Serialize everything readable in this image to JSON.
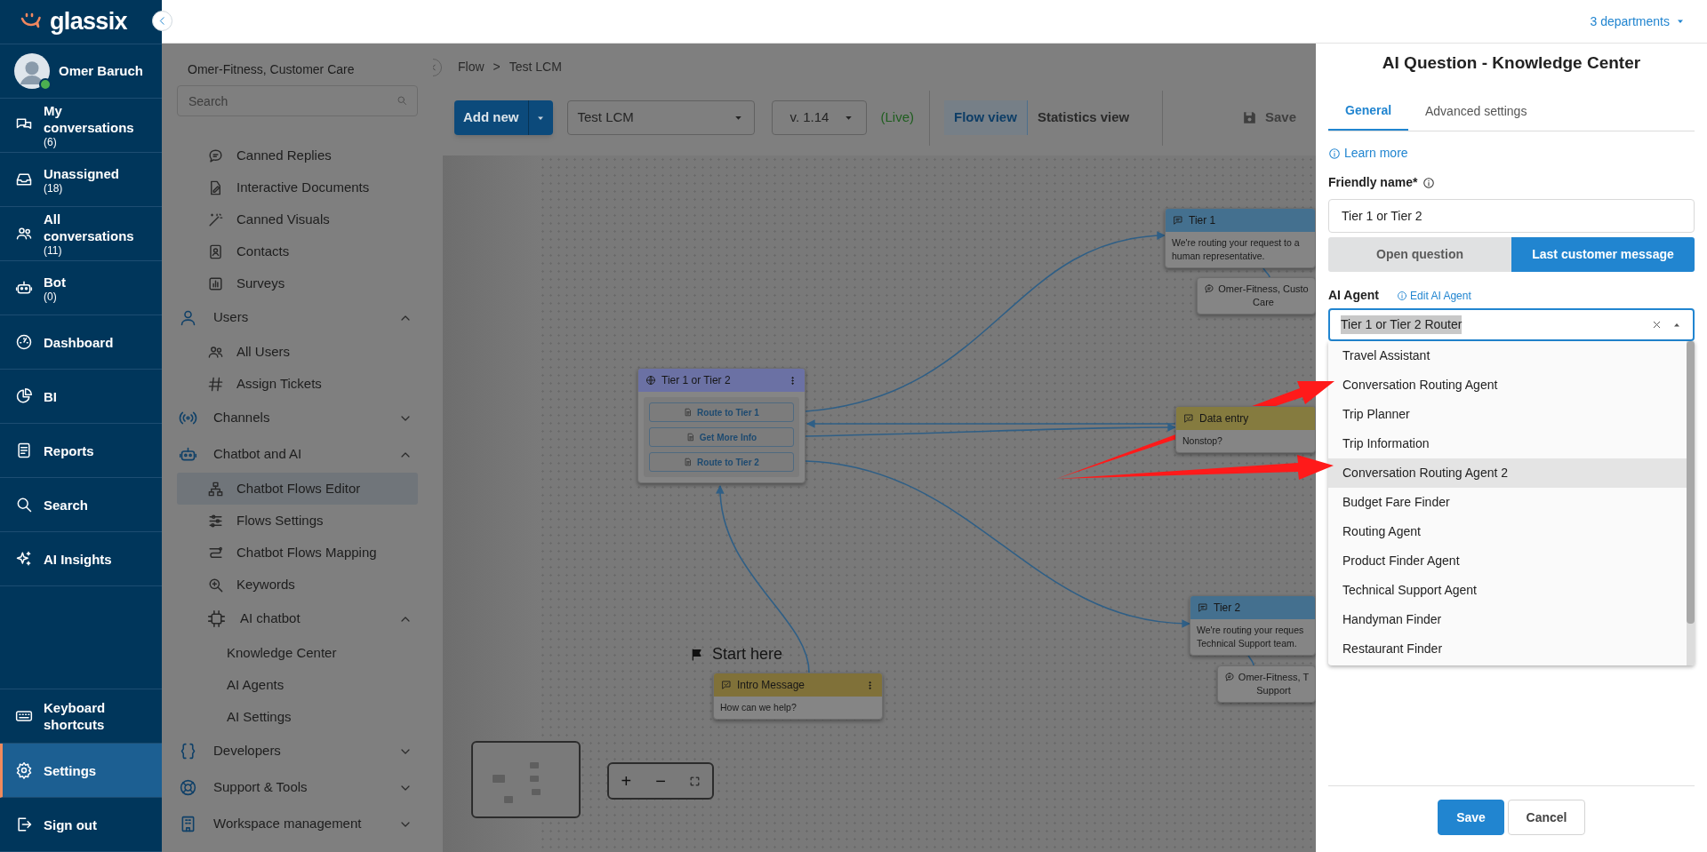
{
  "brand": {
    "name": "glassix"
  },
  "topbar": {
    "departments": "3 departments"
  },
  "user": {
    "name": "Omer Baruch",
    "online": true
  },
  "nav": {
    "items": [
      {
        "label": "My conversations",
        "count": "(6)",
        "selected": false
      },
      {
        "label": "Unassigned",
        "count": "(18)",
        "selected": false
      },
      {
        "label": "All conversations",
        "count": "(11)",
        "selected": false
      },
      {
        "label": "Bot",
        "count": "(0)",
        "selected": false
      },
      {
        "label": "Dashboard",
        "selected": false
      },
      {
        "label": "BI",
        "selected": false
      },
      {
        "label": "Reports",
        "selected": false
      },
      {
        "label": "Search",
        "selected": false
      },
      {
        "label": "AI Insights",
        "selected": false
      }
    ],
    "bottom_items": [
      {
        "label": "Keyboard shortcuts",
        "selected": false
      },
      {
        "label": "Settings",
        "selected": true
      },
      {
        "label": "Sign out",
        "selected": false
      }
    ]
  },
  "settings_nav": {
    "workspace": "Omer-Fitness, Customer Care",
    "search_placeholder": "Search",
    "items": [
      {
        "kind": "item",
        "label": "Canned Replies",
        "selected": false
      },
      {
        "kind": "item",
        "label": "Interactive Documents",
        "selected": false
      },
      {
        "kind": "item",
        "label": "Canned Visuals",
        "selected": false
      },
      {
        "kind": "item",
        "label": "Contacts",
        "selected": false
      },
      {
        "kind": "item",
        "label": "Surveys",
        "selected": false
      },
      {
        "kind": "section",
        "label": "Users",
        "expanded": true,
        "children": [
          {
            "kind": "item",
            "label": "All Users",
            "selected": false
          },
          {
            "kind": "item",
            "label": "Assign Tickets",
            "selected": false
          }
        ]
      },
      {
        "kind": "section",
        "label": "Channels",
        "expanded": false
      },
      {
        "kind": "section",
        "label": "Chatbot and AI",
        "expanded": true,
        "children": [
          {
            "kind": "item",
            "label": "Chatbot Flows Editor",
            "selected": true
          },
          {
            "kind": "item",
            "label": "Flows Settings",
            "selected": false
          },
          {
            "kind": "item",
            "label": "Chatbot Flows Mapping",
            "selected": false
          },
          {
            "kind": "item",
            "label": "Keywords",
            "selected": false
          },
          {
            "kind": "section",
            "label": "AI chatbot",
            "expanded": true,
            "children": [
              {
                "kind": "leaf",
                "label": "Knowledge Center",
                "selected": false
              },
              {
                "kind": "leaf",
                "label": "AI Agents",
                "selected": false
              },
              {
                "kind": "leaf",
                "label": "AI Settings",
                "selected": false
              }
            ]
          }
        ]
      },
      {
        "kind": "section",
        "label": "Developers",
        "expanded": false
      },
      {
        "kind": "section",
        "label": "Support & Tools",
        "expanded": false
      },
      {
        "kind": "section",
        "label": "Workspace management",
        "expanded": false
      }
    ]
  },
  "flow_editor": {
    "breadcrumb": [
      "Flow",
      "Test LCM"
    ],
    "breadcrumb_separator": ">",
    "add_button": "Add new",
    "flow_select": "Test LCM",
    "version_select": "v. 1.14",
    "status": "(Live)",
    "views": [
      {
        "label": "Flow view",
        "selected": true
      },
      {
        "label": "Statistics view",
        "selected": false
      }
    ],
    "save": {
      "label": "Save",
      "disabled": true
    },
    "start_label": "Start here",
    "nodes": [
      {
        "kind": "router",
        "title": "Tier 1 or Tier 2",
        "color": "#6b71a4",
        "menu": true,
        "buttons": [
          "Route to Tier 1",
          "Get More Info",
          "Route to Tier 2"
        ]
      },
      {
        "kind": "message",
        "title": "Tier 1",
        "color": "#44708f",
        "menu": false,
        "text": "We're routing your request to a\nhuman representative."
      },
      {
        "kind": "assignment",
        "text": "Omer-Fitness, Custo\nCare"
      },
      {
        "kind": "input",
        "title": "Data entry",
        "color": "#857b3f",
        "menu": false,
        "text": "Nonstop?"
      },
      {
        "kind": "message",
        "title": "Tier 2",
        "color": "#44708f",
        "menu": false,
        "text": "We're routing your reques\nTechnical Support team."
      },
      {
        "kind": "assignment",
        "text": "Omer-Fitness, T\nSupport"
      },
      {
        "kind": "input",
        "title": "Intro Message",
        "color": "#807139",
        "menu": true,
        "text": "How can we help?"
      }
    ],
    "zoom_controls": [
      "+",
      "−"
    ]
  },
  "panel": {
    "title": "AI Question - Knowledge Center",
    "tabs": [
      {
        "label": "General",
        "selected": true
      },
      {
        "label": "Advanced settings",
        "selected": false
      }
    ],
    "learn_more": "Learn more",
    "friendly_name": {
      "label": "Friendly name*",
      "value": "Tier 1 or Tier 2"
    },
    "question_source": [
      {
        "label": "Open question",
        "selected": false
      },
      {
        "label": "Last customer message",
        "selected": true
      }
    ],
    "agent": {
      "label": "AI Agent",
      "edit_link": "Edit AI Agent",
      "value": "Tier 1 or Tier 2 Router",
      "value_highlighted": true,
      "open": true
    },
    "options": [
      {
        "label": "Travel Assistant",
        "highlighted": false
      },
      {
        "label": "Conversation Routing Agent",
        "highlighted": false
      },
      {
        "label": "Trip Planner",
        "highlighted": false
      },
      {
        "label": "Trip Information",
        "highlighted": false
      },
      {
        "label": "Conversation Routing Agent 2",
        "highlighted": true
      },
      {
        "label": "Budget Fare Finder",
        "highlighted": false
      },
      {
        "label": "Routing Agent",
        "highlighted": false
      },
      {
        "label": "Product Finder Agent",
        "highlighted": false
      },
      {
        "label": "Technical Support Agent",
        "highlighted": false
      },
      {
        "label": "Handyman Finder",
        "highlighted": false
      },
      {
        "label": "Restaurant Finder",
        "highlighted": false
      }
    ],
    "buttons": [
      {
        "label": "Save",
        "kind": "primary"
      },
      {
        "label": "Cancel",
        "kind": "secondary"
      }
    ]
  }
}
